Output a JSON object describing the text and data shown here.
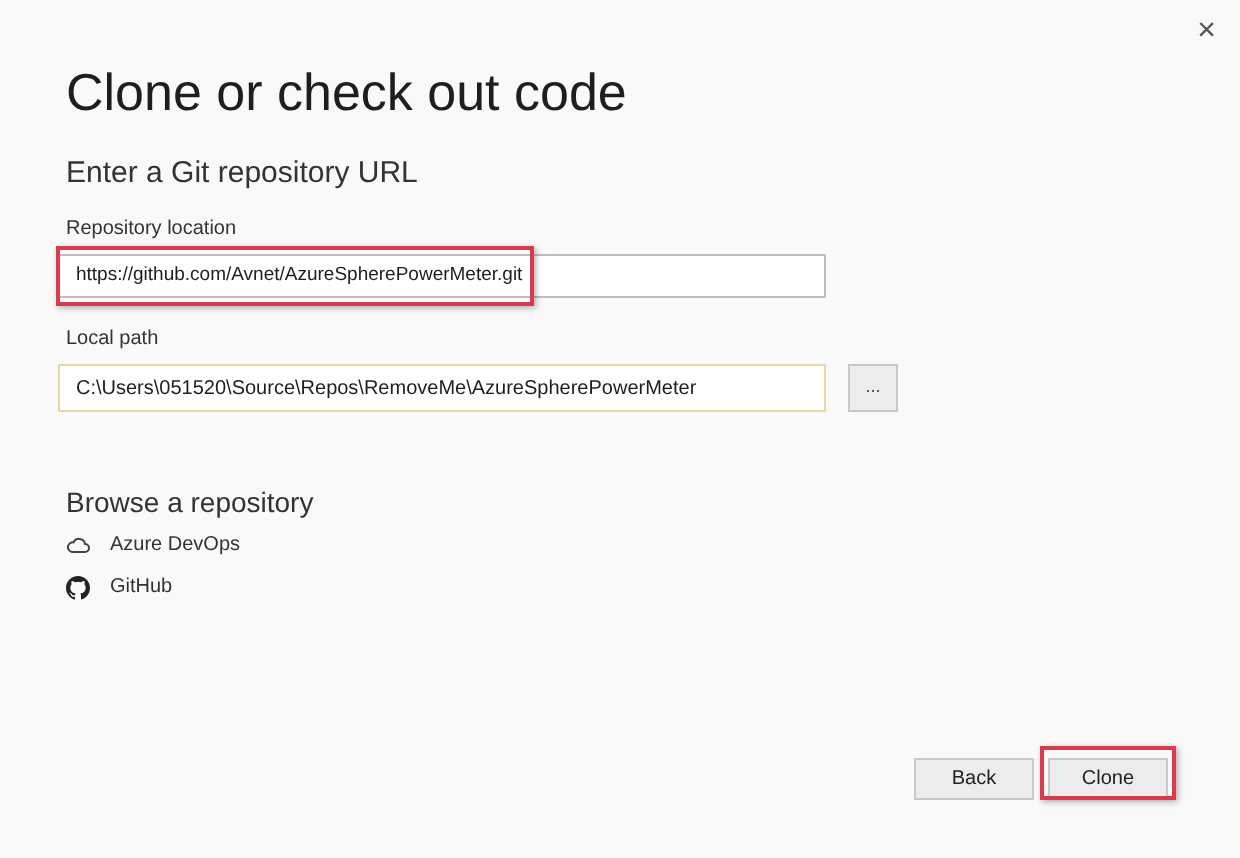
{
  "window": {
    "close": "×"
  },
  "title": "Clone or check out code",
  "section": "Enter a Git repository URL",
  "repository": {
    "label": "Repository location",
    "value": "https://github.com/Avnet/AzureSpherePowerMeter.git",
    "highlighted": true,
    "focused": false
  },
  "local_path": {
    "label": "Local path",
    "value": "C:\\Users\\051520\\Source\\Repos\\RemoveMe\\AzureSpherePowerMeter",
    "focused": true,
    "browse": "..."
  },
  "browse_title": "Browse a repository",
  "providers": [
    {
      "label": "Azure DevOps",
      "kind": "cloud"
    },
    {
      "label": "GitHub",
      "kind": "github"
    }
  ],
  "buttons": [
    {
      "label": "Back",
      "highlighted": false
    },
    {
      "label": "Clone",
      "highlighted": true
    }
  ]
}
